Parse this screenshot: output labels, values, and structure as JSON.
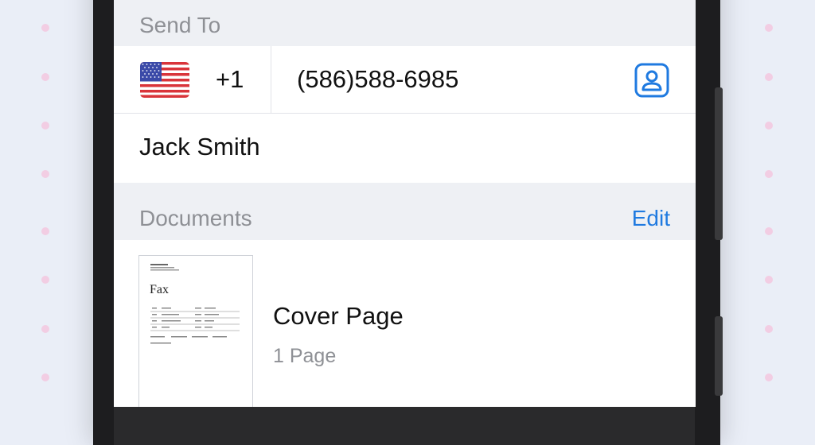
{
  "send_to": {
    "header": "Send To",
    "country_flag_icon": "us-flag-icon",
    "country_code": "+1",
    "phone_number": "(586)588-6985",
    "contact_picker_icon": "contact-card-icon",
    "recipient_name": "Jack Smith"
  },
  "documents": {
    "header": "Documents",
    "edit_label": "Edit",
    "items": [
      {
        "thumbnail_text": "Fax",
        "title": "Cover Page",
        "pages": "1 Page"
      }
    ]
  },
  "colors": {
    "accent": "#1f7ae0",
    "secondary_text": "#8e9095",
    "section_bg": "#eef0f4"
  }
}
